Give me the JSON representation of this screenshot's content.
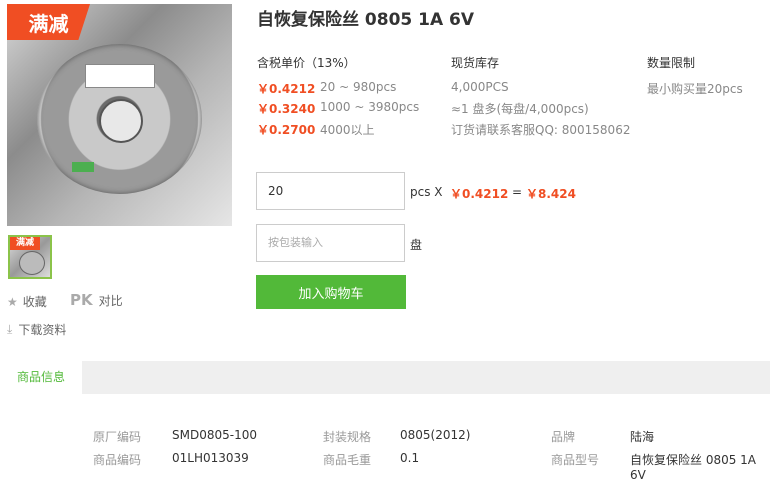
{
  "badge": "满减",
  "thumb_badge": "满减",
  "title": "自恢复保险丝 0805 1A 6V",
  "side_links": {
    "favorite": "收藏",
    "pk": "PK",
    "compare": "对比",
    "download": "下载资料"
  },
  "price_header": "含税单价（13%）",
  "stock_header": "现货库存",
  "limit_header": "数量限制",
  "tiers": [
    {
      "price": "￥0.4212",
      "range": "20 ~ 980pcs"
    },
    {
      "price": "￥0.3240",
      "range": "1000 ~ 3980pcs"
    },
    {
      "price": "￥0.2700",
      "range": "4000以上"
    }
  ],
  "stock": [
    "4,000PCS",
    "≈1 盘多(每盘/4,000pcs)",
    "订货请联系客服QQ: 800158062"
  ],
  "limit": "最小购买量20pcs",
  "order": {
    "qty_value": "20",
    "qty_unit": "pcs X",
    "unit_price": "￥0.4212",
    "equals": "=",
    "total": "￥8.424",
    "pkg_placeholder": "按包装输入",
    "pkg_unit": "盘",
    "cart_label": "加入购物车"
  },
  "tab_label": "商品信息",
  "specs": {
    "row1": [
      {
        "label": "原厂编码",
        "value": "SMD0805-100"
      },
      {
        "label": "封装规格",
        "value": "0805(2012)"
      },
      {
        "label": "品牌",
        "value": "陆海"
      }
    ],
    "row2": [
      {
        "label": "商品编码",
        "value": "01LH013039"
      },
      {
        "label": "商品毛重",
        "value": "0.1"
      },
      {
        "label": "商品型号",
        "value": "自恢复保险丝 0805 1A 6V"
      }
    ]
  },
  "colors": {
    "accent_red": "#f04e23",
    "button_green": "#52b939",
    "tab_green": "#52b939"
  }
}
